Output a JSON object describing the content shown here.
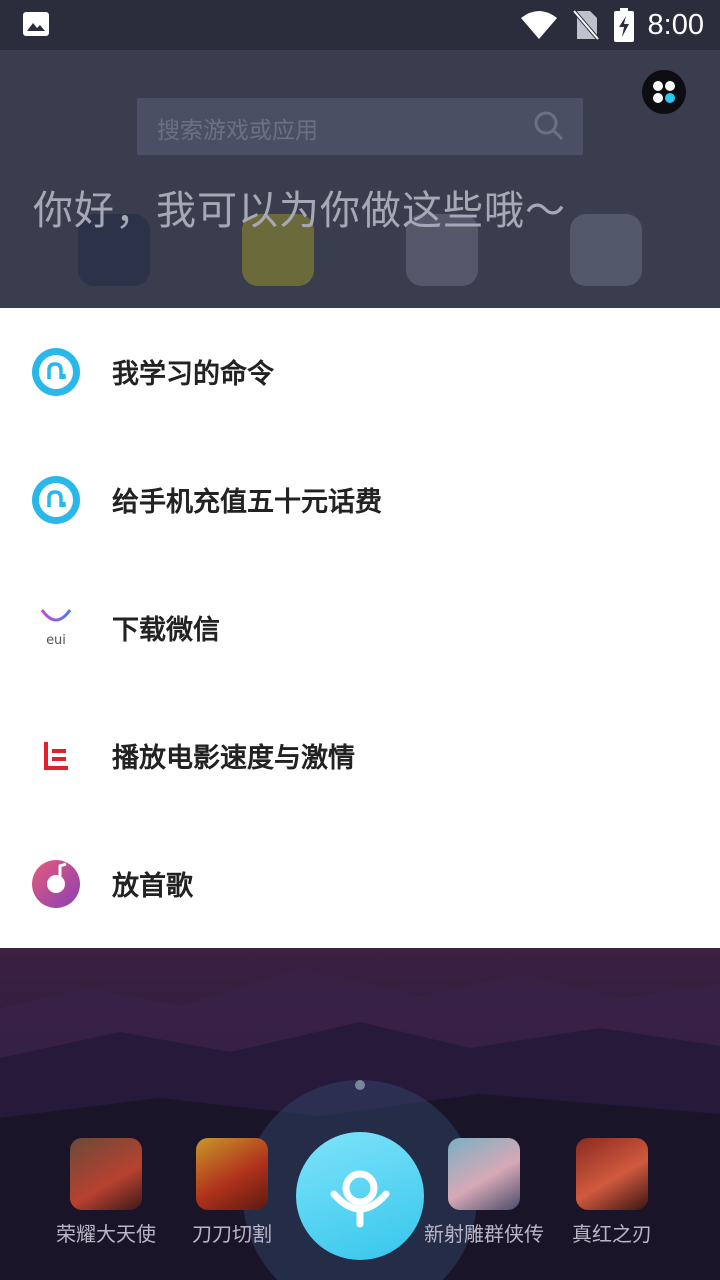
{
  "status_bar": {
    "time": "8:00",
    "icons": [
      "image-icon",
      "wifi-icon",
      "no-sim-icon",
      "battery-charging-icon"
    ]
  },
  "background_app": {
    "search_placeholder": "搜索游戏或应用"
  },
  "assistant": {
    "greeting": "你好，我可以为你做这些哦～",
    "menu_icon": "apps-grid-icon"
  },
  "suggestions": [
    {
      "label": "我学习的命令",
      "icon": "assistant-icon"
    },
    {
      "label": "给手机充值五十元话费",
      "icon": "assistant-icon"
    },
    {
      "label": "下载微信",
      "icon": "eui-icon"
    },
    {
      "label": "播放电影速度与激情",
      "icon": "letv-icon"
    },
    {
      "label": "放首歌",
      "icon": "music-disc-icon"
    }
  ],
  "bottom_games": [
    {
      "label": "荣耀大天使"
    },
    {
      "label": "刀刀切割"
    },
    {
      "label": "新射雕群侠传"
    },
    {
      "label": "真红之刃"
    }
  ],
  "colors": {
    "accent": "#35c6ec",
    "card_bg": "#ffffff",
    "overlay": "#3a3d4e"
  }
}
